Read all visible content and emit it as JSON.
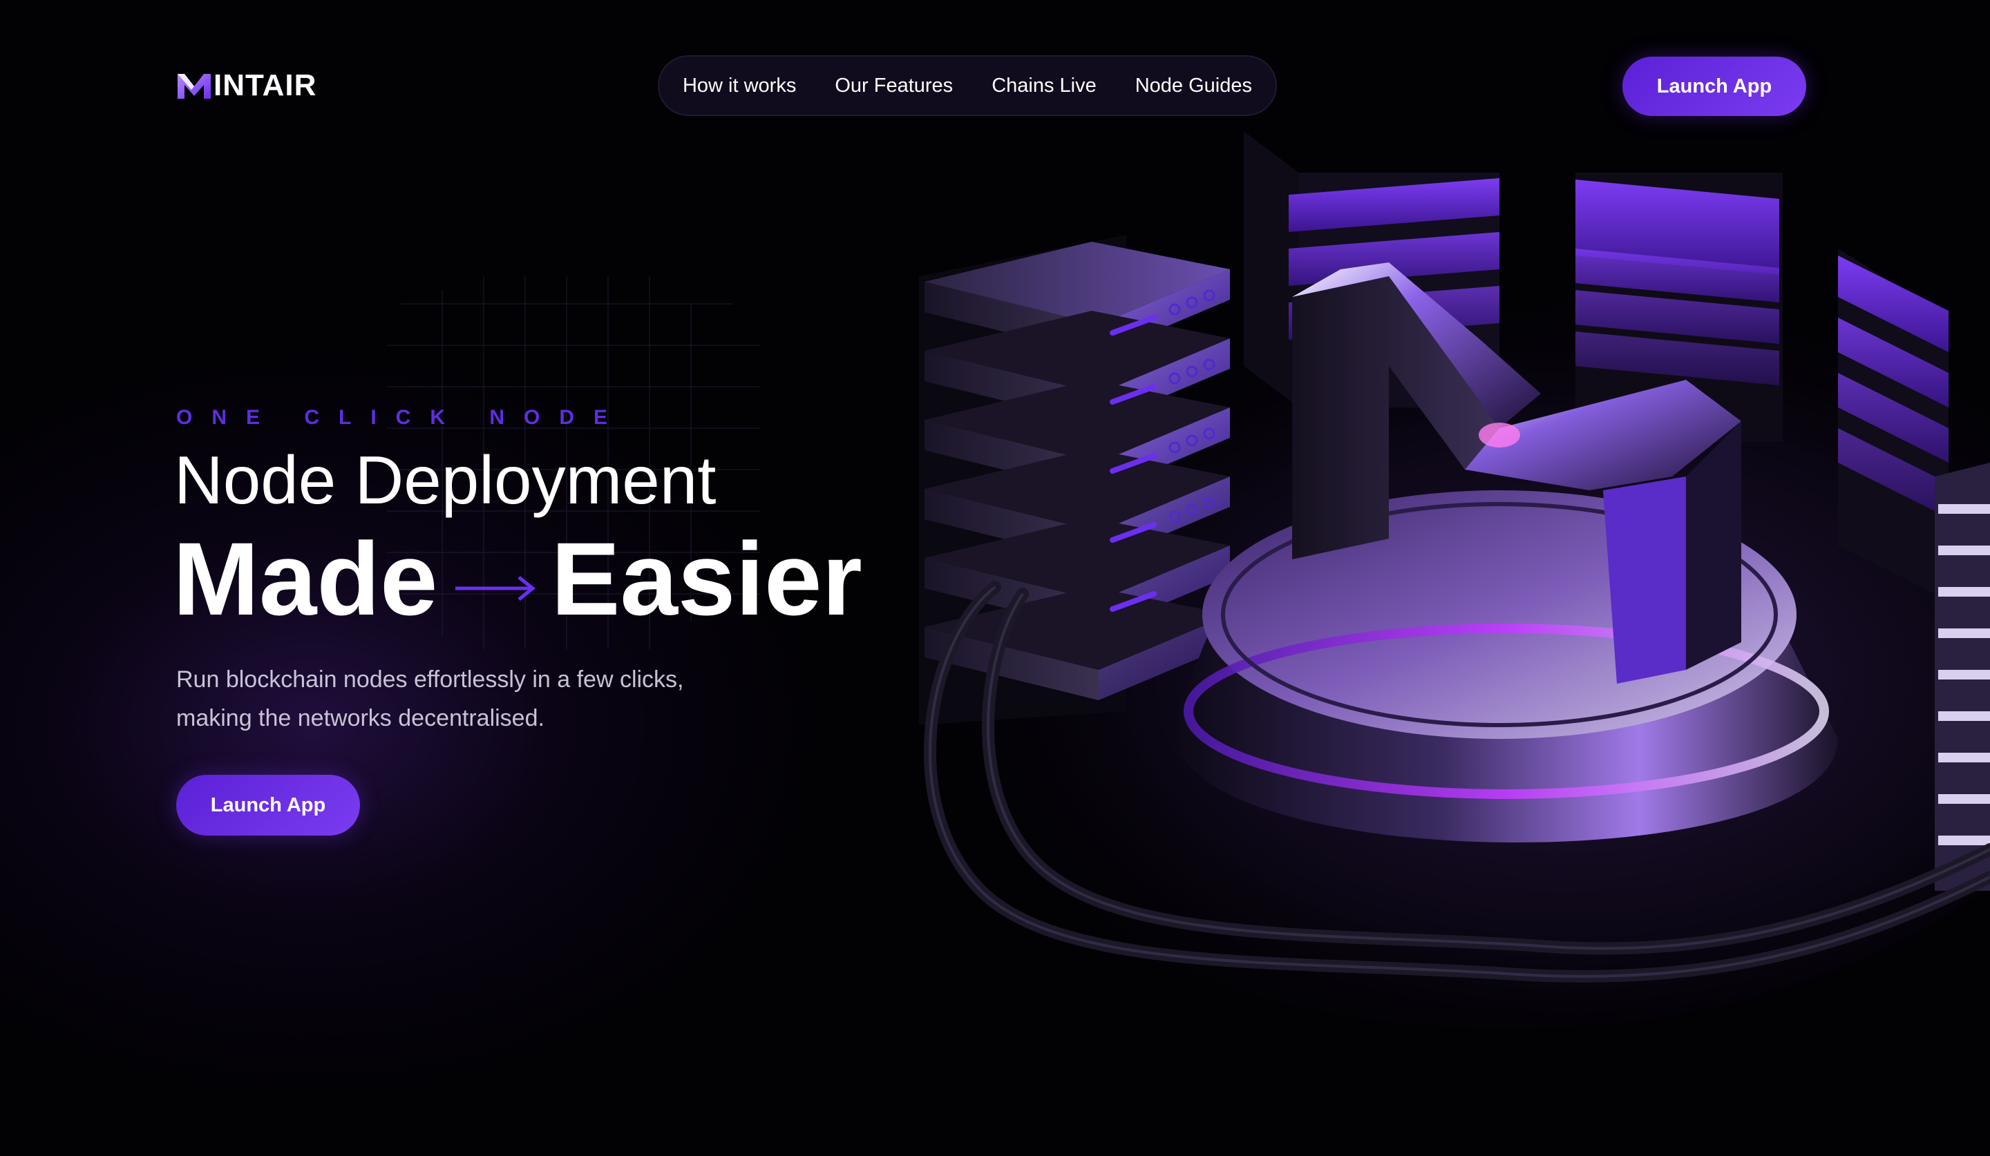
{
  "brand": {
    "name": "INTAIR",
    "logo_letter": "M"
  },
  "nav": {
    "items": [
      {
        "label": "How it works"
      },
      {
        "label": "Our Features"
      },
      {
        "label": "Chains Live"
      },
      {
        "label": "Node Guides"
      }
    ]
  },
  "header": {
    "cta_label": "Launch App"
  },
  "hero": {
    "kicker": "ONE CLICK NODE",
    "title_line1": "Node Deployment",
    "title_word1": "Made",
    "title_word2": "Easier",
    "subtitle_line1": "Run blockchain nodes effortlessly in a few clicks,",
    "subtitle_line2": "making the networks decentralised.",
    "cta_label": "Launch App"
  },
  "colors": {
    "accent": "#6b2ff0",
    "kicker": "#5f2ee0",
    "background": "#020104"
  },
  "icons": {
    "arrow": "arrow-right-icon"
  }
}
